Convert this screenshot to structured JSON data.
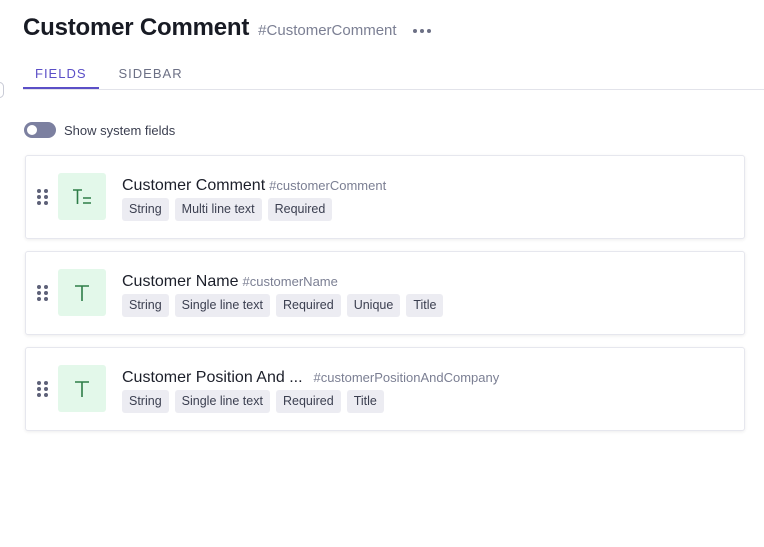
{
  "model": {
    "title": "Customer Comment",
    "api_id": "#CustomerComment"
  },
  "tabs": [
    {
      "label": "FIELDS",
      "active": true
    },
    {
      "label": "SIDEBAR",
      "active": false
    }
  ],
  "system_fields_toggle": {
    "label": "Show system fields",
    "on": false
  },
  "fields": [
    {
      "name": "Customer Comment",
      "api_id": "#customerComment",
      "icon": "multi-line-text-icon",
      "tags": [
        "String",
        "Multi line text",
        "Required"
      ]
    },
    {
      "name": "Customer Name",
      "api_id": "#customerName",
      "icon": "single-line-text-icon",
      "tags": [
        "String",
        "Single line text",
        "Required",
        "Unique",
        "Title"
      ]
    },
    {
      "name": "Customer Position And ...",
      "api_id": "#customerPositionAndCompany",
      "icon": "single-line-text-icon",
      "tags": [
        "String",
        "Single line text",
        "Required",
        "Title"
      ]
    }
  ],
  "colors": {
    "accent": "#5b4fc7",
    "field_icon_bg": "#e3f8ea",
    "field_icon_fg": "#2e7d48",
    "tag_bg": "#ececf2"
  }
}
